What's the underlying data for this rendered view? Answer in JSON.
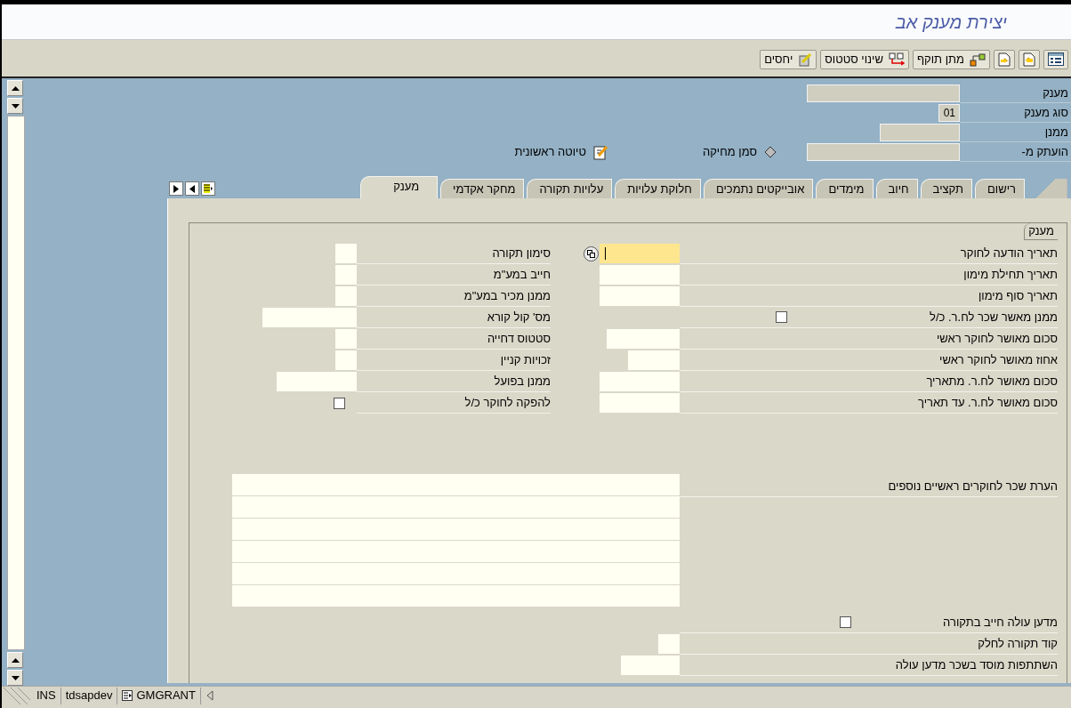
{
  "window": {
    "title": "יצירת מענק אב"
  },
  "toolbar": [
    {
      "kind": "icon"
    },
    {
      "kind": "icon"
    },
    {
      "kind": "icon"
    },
    {
      "kind": "text",
      "label": "מתן תוקף"
    },
    {
      "kind": "text",
      "label": "שינוי סטטוס"
    },
    {
      "kind": "text",
      "label": "יחסים"
    }
  ],
  "header": {
    "fields": [
      {
        "label": "מענק"
      },
      {
        "label": "סוג מענק",
        "value": "01"
      },
      {
        "label": "ממנן"
      },
      {
        "label": "הועתק מ-"
      }
    ],
    "flags": [
      {
        "label": "סמן מחיקה"
      },
      {
        "label": "טיוטה ראשונית"
      }
    ]
  },
  "tabs": [
    {
      "label": "רישום",
      "selected": false
    },
    {
      "label": "תקציב",
      "selected": false
    },
    {
      "label": "חיוב",
      "selected": false
    },
    {
      "label": "מימדים",
      "selected": false
    },
    {
      "label": "אובייקטים נתמכים",
      "selected": false
    },
    {
      "label": "חלוקת עלויות",
      "selected": false
    },
    {
      "label": "עלויות תקורה",
      "selected": false
    },
    {
      "label": "מחקר אקדמי",
      "selected": false
    },
    {
      "label": "מענק",
      "selected": true
    }
  ],
  "group": {
    "title": "מענק",
    "right_fields": [
      {
        "kind": "input",
        "label": "תאריך הודעה לחוקר",
        "focused": true,
        "help": true
      },
      {
        "kind": "input",
        "label": "תאריך תחילת מימון",
        "focused": false,
        "help": false
      },
      {
        "kind": "input",
        "label": "תאריך סוף מימון",
        "focused": false,
        "help": false
      },
      {
        "kind": "checkbox",
        "label": "ממנן מאשר שכר לח.ר. כ/ל",
        "checked": false
      },
      {
        "kind": "input",
        "label": "סכום מאושר לחוקר ראשי",
        "focused": false,
        "help": false
      },
      {
        "kind": "input",
        "label": "אחוז מאושר לחוקר ראשי",
        "focused": false,
        "help": false
      },
      {
        "kind": "input",
        "label": "סכום מאושר לח.ר. מתאריך",
        "focused": false,
        "help": false
      },
      {
        "kind": "input",
        "label": "סכום מאושר לח.ר. עד תאריך",
        "focused": false,
        "help": false
      }
    ],
    "left_fields": [
      {
        "kind": "input",
        "label": "סימון תקורה"
      },
      {
        "kind": "input",
        "label": "חייב במע\"מ"
      },
      {
        "kind": "input",
        "label": "ממנן מכיר במע\"מ"
      },
      {
        "kind": "input",
        "label": "מס' קול קורא"
      },
      {
        "kind": "input",
        "label": "סטטוס דחייה"
      },
      {
        "kind": "input",
        "label": "זכויות קניין"
      },
      {
        "kind": "input",
        "label": "ממנן בפועל"
      },
      {
        "kind": "checkbox",
        "label": "להפקה לחוקר כ/ל",
        "checked": false
      }
    ],
    "note": {
      "label": "הערת שכר לחוקרים ראשיים נוספים"
    },
    "bottom_fields": [
      {
        "kind": "checkbox",
        "label": "מדען עולה חייב בתקורה",
        "checked": false
      },
      {
        "kind": "input",
        "label": "קוד תקורה לחלק"
      },
      {
        "kind": "input",
        "label": "השתתפות מוסד בשכר מדען עולה"
      }
    ]
  },
  "status_bar": [
    {
      "kind": "program",
      "text": "GMGRANT"
    },
    {
      "kind": "system",
      "text": "tdsapdev"
    },
    {
      "kind": "mode",
      "text": "INS"
    }
  ]
}
